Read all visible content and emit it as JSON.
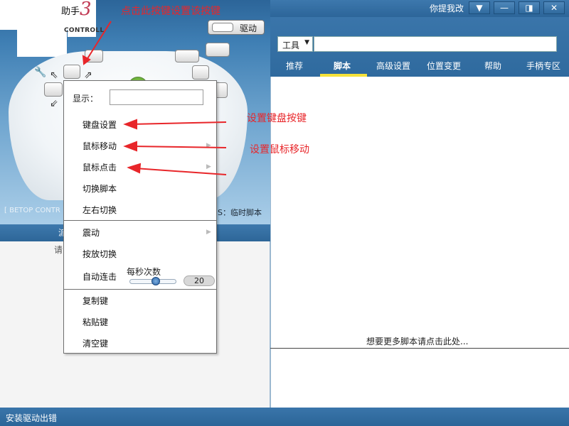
{
  "window": {
    "title": "助手",
    "title_number": "3",
    "subtitle": "CONTROLL",
    "feedback": "你提我改",
    "controls": [
      "▼",
      "—",
      "◨",
      "✕"
    ]
  },
  "driver_button": {
    "label": "驱动"
  },
  "left_panel": {
    "bottom_left": "[ BETOP CONTR",
    "bottom_right": "S：临时脚本",
    "band_text": "派",
    "white_text": "请"
  },
  "toolbar": {
    "tool_select": "工具"
  },
  "tabs": [
    {
      "label": "推荐",
      "active": false
    },
    {
      "label": "脚本",
      "active": true
    },
    {
      "label": "高级设置",
      "active": false
    },
    {
      "label": "位置变更",
      "active": false
    },
    {
      "label": "帮助",
      "active": false
    },
    {
      "label": "手柄专区",
      "active": false
    }
  ],
  "more_scripts": "想要更多脚本请点击此处...",
  "status": "安装驱动出错",
  "context_menu": {
    "display_label": "显示：",
    "items": [
      "键盘设置",
      "鼠标移动",
      "鼠标点击",
      "切换脚本",
      "左右切换"
    ],
    "items2": [
      "震动",
      "按放切换",
      "自动连击"
    ],
    "items3": [
      "复制键",
      "粘贴键",
      "清空键"
    ],
    "per_second_label": "每秒次数",
    "per_second_value": "20"
  },
  "annotations": {
    "top": "点击此按键设置该按键",
    "keyboard": "设置键盘按键",
    "mouse": "设置鼠标移动"
  },
  "colors": {
    "accent": "#2f6a9e",
    "annotation": "#e8262a",
    "tab_underline": "#f5e23a"
  }
}
